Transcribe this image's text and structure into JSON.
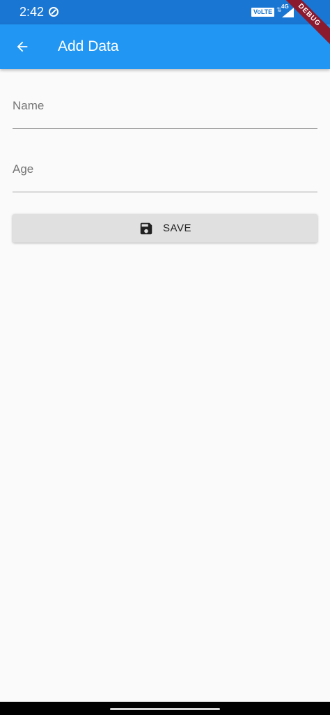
{
  "status_bar": {
    "time": "2:42",
    "volte_label": "VoLTE",
    "network_type": "4G",
    "data_arrows": "⇅",
    "app_icon": "data-saver-icon",
    "signal_icon": "signal-icon",
    "bg_color": "#1976d2"
  },
  "debug_banner": {
    "label": "DEBUG",
    "color": "#8b1a2f"
  },
  "app_bar": {
    "title": "Add Data",
    "back_icon": "arrow-back-icon",
    "bg_color": "#2196f3"
  },
  "form": {
    "name_field": {
      "label": "Name",
      "value": ""
    },
    "age_field": {
      "label": "Age",
      "value": ""
    },
    "save_button": {
      "label": "SAVE",
      "icon": "save-icon"
    }
  },
  "colors": {
    "background": "#fafafa",
    "button_bg": "#e0e0e0",
    "label_text": "#757575"
  }
}
